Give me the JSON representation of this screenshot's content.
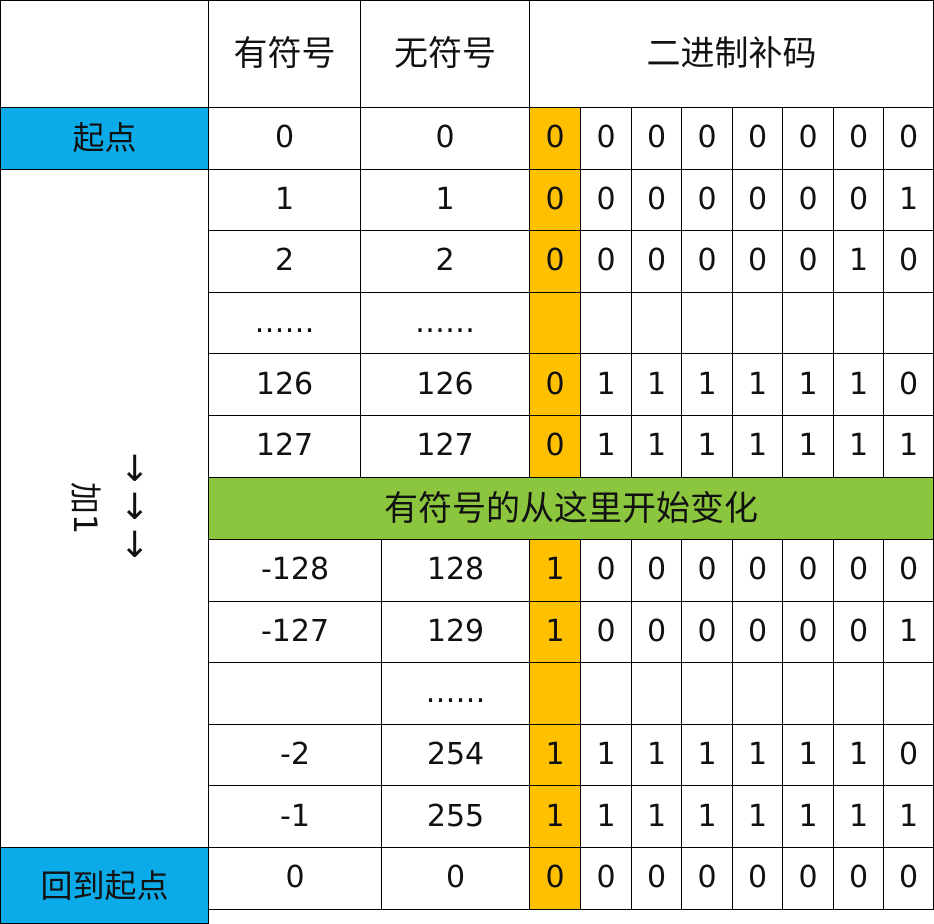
{
  "headers": {
    "corner": "",
    "signed": "有符号",
    "unsigned": "无符号",
    "binary": "二进制补码"
  },
  "start_label": "起点",
  "side_label": "加1",
  "side_arrows": [
    "↓",
    "↓",
    "↓"
  ],
  "banner": "有符号的从这里开始变化",
  "end_label": "回到起点",
  "rows_top": [
    {
      "signed": "0",
      "unsigned": "0",
      "bits": [
        "0",
        "0",
        "0",
        "0",
        "0",
        "0",
        "0",
        "0"
      ]
    },
    {
      "signed": "1",
      "unsigned": "1",
      "bits": [
        "0",
        "0",
        "0",
        "0",
        "0",
        "0",
        "0",
        "1"
      ]
    },
    {
      "signed": "2",
      "unsigned": "2",
      "bits": [
        "0",
        "0",
        "0",
        "0",
        "0",
        "0",
        "1",
        "0"
      ]
    },
    {
      "signed": "……",
      "unsigned": "……",
      "bits": [
        "",
        "",
        "",
        "",
        "",
        "",
        "",
        ""
      ]
    },
    {
      "signed": "126",
      "unsigned": "126",
      "bits": [
        "0",
        "1",
        "1",
        "1",
        "1",
        "1",
        "1",
        "0"
      ]
    },
    {
      "signed": "127",
      "unsigned": "127",
      "bits": [
        "0",
        "1",
        "1",
        "1",
        "1",
        "1",
        "1",
        "1"
      ]
    }
  ],
  "rows_bottom": [
    {
      "signed": "-128",
      "unsigned": "128",
      "bits": [
        "1",
        "0",
        "0",
        "0",
        "0",
        "0",
        "0",
        "0"
      ]
    },
    {
      "signed": "-127",
      "unsigned": "129",
      "bits": [
        "1",
        "0",
        "0",
        "0",
        "0",
        "0",
        "0",
        "1"
      ]
    },
    {
      "signed": "",
      "unsigned": "……",
      "bits": [
        "",
        "",
        "",
        "",
        "",
        "",
        "",
        ""
      ]
    },
    {
      "signed": "-2",
      "unsigned": "254",
      "bits": [
        "1",
        "1",
        "1",
        "1",
        "1",
        "1",
        "1",
        "0"
      ]
    },
    {
      "signed": "-1",
      "unsigned": "255",
      "bits": [
        "1",
        "1",
        "1",
        "1",
        "1",
        "1",
        "1",
        "1"
      ]
    },
    {
      "signed": "0",
      "unsigned": "0",
      "bits": [
        "0",
        "0",
        "0",
        "0",
        "0",
        "0",
        "0",
        "0"
      ]
    }
  ],
  "colors": {
    "label_blue": "#0baae8",
    "sign_bit": "#ffc000",
    "banner_green": "#8cc63f"
  }
}
